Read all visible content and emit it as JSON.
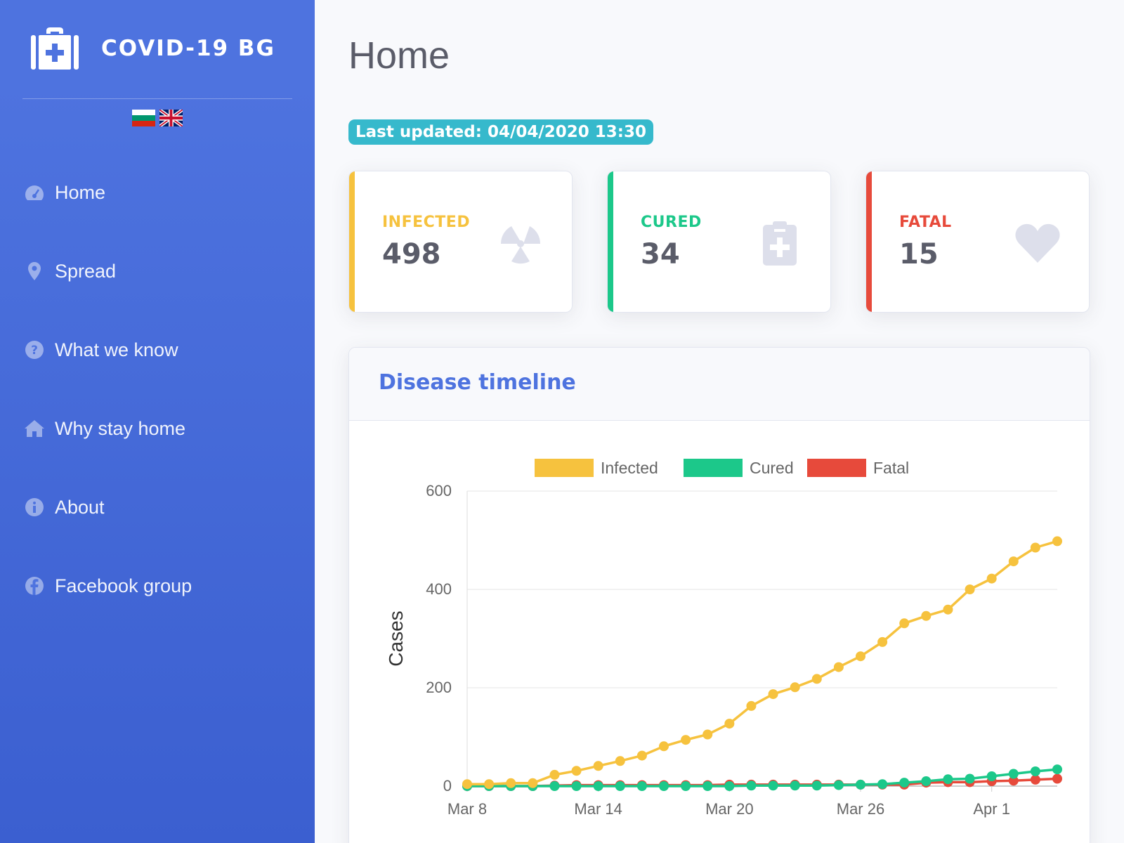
{
  "app": {
    "brand": "COVID-19 BG",
    "brand_icon": "medkit-icon",
    "languages": [
      "bg",
      "en"
    ]
  },
  "sidebar": {
    "items": [
      {
        "label": "Home",
        "icon": "tachometer-icon"
      },
      {
        "label": "Spread",
        "icon": "map-marker-icon"
      },
      {
        "label": "What we know",
        "icon": "question-circle-icon"
      },
      {
        "label": "Why stay home",
        "icon": "home-icon"
      },
      {
        "label": "About",
        "icon": "info-circle-icon"
      },
      {
        "label": "Facebook group",
        "icon": "facebook-icon"
      }
    ]
  },
  "page": {
    "title": "Home",
    "last_updated": "Last updated: 04/04/2020 13:30"
  },
  "stats": [
    {
      "label": "INFECTED",
      "value": "498",
      "color": "#f6c23e",
      "icon": "radiation-icon"
    },
    {
      "label": "CURED",
      "value": "34",
      "color": "#1cc88a",
      "icon": "clipboard-medical-icon"
    },
    {
      "label": "FATAL",
      "value": "15",
      "color": "#e74a3b",
      "icon": "heart-icon"
    }
  ],
  "timeline": {
    "title": "Disease timeline"
  },
  "chart_data": {
    "type": "line",
    "ylabel": "Cases",
    "ylim": [
      0,
      600
    ],
    "yticks": [
      0,
      200,
      400,
      600
    ],
    "x": [
      "Mar 8",
      "Mar 9",
      "Mar 10",
      "Mar 11",
      "Mar 12",
      "Mar 13",
      "Mar 14",
      "Mar 15",
      "Mar 16",
      "Mar 17",
      "Mar 18",
      "Mar 19",
      "Mar 20",
      "Mar 21",
      "Mar 22",
      "Mar 23",
      "Mar 24",
      "Mar 25",
      "Mar 26",
      "Mar 27",
      "Mar 28",
      "Mar 29",
      "Mar 30",
      "Mar 31",
      "Apr 1",
      "Apr 2",
      "Apr 3",
      "Apr 4"
    ],
    "xtick_labels": [
      "Mar 8",
      "Mar 14",
      "Mar 20",
      "Mar 26",
      "Apr 1"
    ],
    "grid": true,
    "legend": "top",
    "series": [
      {
        "name": "Infected",
        "color": "#f6c23e",
        "values": [
          4,
          4,
          6,
          6,
          23,
          31,
          41,
          51,
          62,
          81,
          94,
          105,
          127,
          163,
          187,
          201,
          218,
          242,
          264,
          293,
          331,
          346,
          359,
          400,
          422,
          457,
          485,
          498
        ]
      },
      {
        "name": "Cured",
        "color": "#1cc88a",
        "values": [
          0,
          0,
          0,
          0,
          0,
          0,
          0,
          0,
          0,
          0,
          0,
          0,
          0,
          1,
          1,
          1,
          1,
          2,
          3,
          4,
          7,
          10,
          14,
          15,
          20,
          25,
          30,
          34
        ]
      },
      {
        "name": "Fatal",
        "color": "#e74a3b",
        "values": [
          0,
          0,
          0,
          0,
          1,
          2,
          2,
          2,
          2,
          2,
          2,
          2,
          3,
          3,
          3,
          3,
          3,
          3,
          3,
          3,
          3,
          7,
          8,
          8,
          10,
          11,
          13,
          15
        ]
      }
    ]
  }
}
